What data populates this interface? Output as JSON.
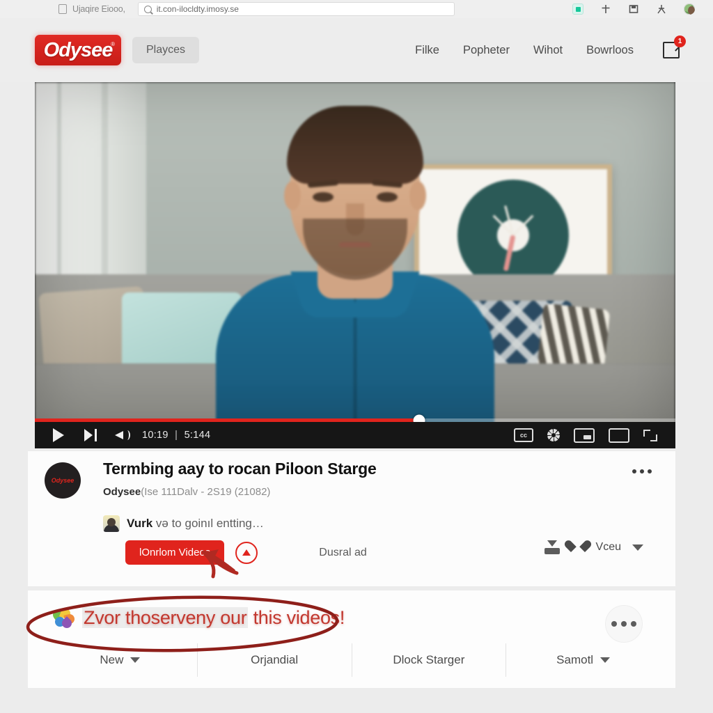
{
  "browser": {
    "tab_title": "Ujaqire Eiooo,",
    "url": "it.con-ilocldty.imosy.se",
    "icons": [
      "tab-icon",
      "search-icon",
      "extension-icon",
      "add-icon",
      "save-icon",
      "people-icon",
      "profile-avatar"
    ]
  },
  "header": {
    "logo_text": "Odysee",
    "logo_mark": "®",
    "logo_color": "#d41e18",
    "pill_label": "Playces",
    "nav_items": [
      {
        "label": "Filke"
      },
      {
        "label": "Popheter"
      },
      {
        "label": "Wihot"
      },
      {
        "label": "Bowrloos"
      }
    ],
    "notification_icon": "external-link-icon",
    "notification_count": "1"
  },
  "player": {
    "play_icon": "play-icon",
    "next_icon": "next-track-icon",
    "volume_icon": "volume-icon",
    "current_time": "10:19",
    "time_separator": "|",
    "duration": "5:144",
    "progress_percent": 60,
    "thumb_label": "",
    "cc_label": "cc",
    "right_icons": [
      "captions-icon",
      "settings-gear-icon",
      "miniplayer-icon",
      "theater-mode-icon",
      "fullscreen-icon"
    ],
    "accent_color": "#e0241d"
  },
  "video_info": {
    "channel_avatar_text": "Odysee",
    "title": "Termbing aay to rocan Piloon Starge",
    "meta_channel": "Odysee",
    "meta_rest": "(Ise 111Dalv  -  2S19 (21082)",
    "description_author": "Vurk",
    "description_text": "və to goinıl entting…",
    "primary_button": "lOnrlom Videos",
    "badge_icon": "alert-circle-icon",
    "ad_label": "Dusral ad",
    "overflow_icon": "more-options-icon",
    "download_icon": "download-icon",
    "like_icon": "heart-icon",
    "like_label": "Vceu",
    "dropdown_icon": "chevron-down-icon"
  },
  "promo": {
    "flower_icon": "flower-icon",
    "highlighted_text": "Zvor thoserveny our",
    "trailing_text": "this videos!",
    "text_color": "#c2382f",
    "overflow_icon": "more-options-icon"
  },
  "bottom_tabs": [
    {
      "label": "New",
      "has_caret": true
    },
    {
      "label": "Orjandial",
      "has_caret": false
    },
    {
      "label": "Dlock Starger",
      "has_caret": false
    },
    {
      "label": "Samotl",
      "has_caret": true
    }
  ]
}
